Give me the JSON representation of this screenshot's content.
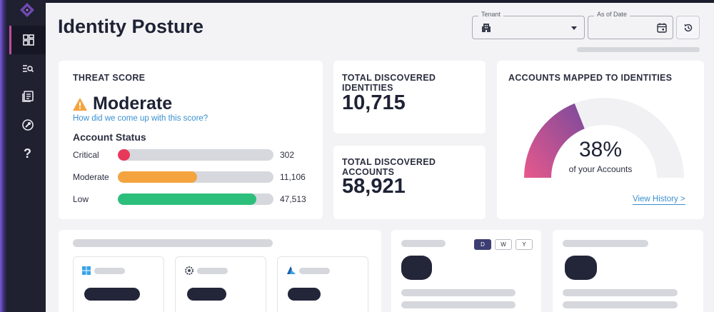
{
  "page": {
    "title": "Identity Posture"
  },
  "filters": {
    "tenant": {
      "label": "Tenant",
      "value": ""
    },
    "as_of_date": {
      "label": "As of Date",
      "value": ""
    }
  },
  "sidebar": {
    "items": [
      {
        "name": "dashboard",
        "icon": "dashboard-icon",
        "active": true
      },
      {
        "name": "search",
        "icon": "list-search-icon",
        "active": false
      },
      {
        "name": "reports",
        "icon": "reports-icon",
        "active": false
      },
      {
        "name": "tools",
        "icon": "wrench-icon",
        "active": false
      },
      {
        "name": "help",
        "label": "?",
        "active": false
      }
    ]
  },
  "threat_score": {
    "title": "THREAT SCORE",
    "level": "Moderate",
    "level_icon": "warning-icon",
    "explain_link": "How did we come up with this score?",
    "account_status_title": "Account Status",
    "rows": [
      {
        "label": "Critical",
        "value": "302",
        "fraction": 0.08,
        "color": "#e8395a"
      },
      {
        "label": "Moderate",
        "value": "11,106",
        "fraction": 0.51,
        "color": "#f4a43e"
      },
      {
        "label": "Low",
        "value": "47,513",
        "fraction": 0.89,
        "color": "#2cbf7c"
      }
    ]
  },
  "total_identities": {
    "title": "TOTAL DISCOVERED IDENTITIES",
    "value": "10,715"
  },
  "total_accounts": {
    "title": "TOTAL DISCOVERED ACCOUNTS",
    "value": "58,921"
  },
  "accounts_mapped": {
    "title": "ACCOUNTS MAPPED TO IDENTITIES",
    "percent_label": "38%",
    "percent": 0.38,
    "subtitle": "of your Accounts",
    "link": "View History >",
    "gauge_colors": [
      "#e8588c",
      "#7b4a9c"
    ]
  },
  "period_toggle": {
    "options": [
      "D",
      "W",
      "Y"
    ],
    "selected": "D"
  },
  "colors": {
    "accent": "#3a8fd0",
    "sidebar": "#1f2030",
    "active_nav": "#c14aa3"
  }
}
